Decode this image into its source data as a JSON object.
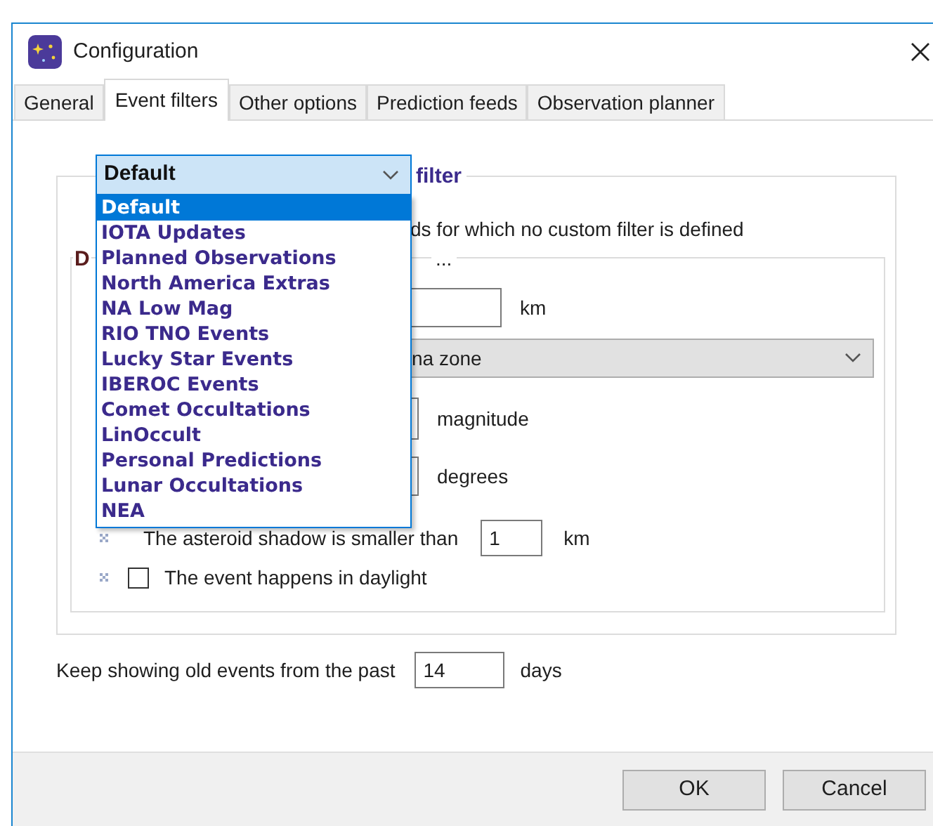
{
  "window": {
    "title": "Configuration"
  },
  "tabs": [
    {
      "label": "General",
      "selected": false
    },
    {
      "label": "Event filters",
      "selected": true
    },
    {
      "label": "Other options",
      "selected": false
    },
    {
      "label": "Prediction feeds",
      "selected": false
    },
    {
      "label": "Observation planner",
      "selected": false
    }
  ],
  "filter_group": {
    "title": "filter",
    "filter_select": {
      "value": "Default",
      "expanded": true,
      "options": [
        {
          "label": "Default",
          "selected": true
        },
        {
          "label": "IOTA Updates",
          "selected": false
        },
        {
          "label": "Planned Observations",
          "selected": false
        },
        {
          "label": "North America Extras",
          "selected": false
        },
        {
          "label": "NA Low Mag",
          "selected": false
        },
        {
          "label": "RIO TNO Events",
          "selected": false
        },
        {
          "label": "Lucky Star Events",
          "selected": false
        },
        {
          "label": "IBEROC Events",
          "selected": false
        },
        {
          "label": "Comet Occultations",
          "selected": false
        },
        {
          "label": "LinOccult",
          "selected": false
        },
        {
          "label": "Personal Predictions",
          "selected": false
        },
        {
          "label": "Lunar Occultations",
          "selected": false
        },
        {
          "label": "NEA",
          "selected": false
        }
      ]
    },
    "description": "ds for which no custom filter is defined",
    "criteria_group": {
      "title": "D",
      "title_2": "...",
      "distance": {
        "unit": "km"
      },
      "zone_select": {
        "value": "na zone"
      },
      "magnitude": {
        "unit": "magnitude"
      },
      "elevation": {
        "unit": "degrees"
      },
      "shadow": {
        "label": "The asteroid shadow is smaller than",
        "value": "1",
        "unit": "km"
      },
      "daylight": {
        "label": "The event happens in daylight",
        "checked": false
      }
    }
  },
  "past_days": {
    "label": "Keep showing old events from the past",
    "value": "14",
    "unit": "days"
  },
  "buttons": [
    "OK",
    "Cancel"
  ]
}
